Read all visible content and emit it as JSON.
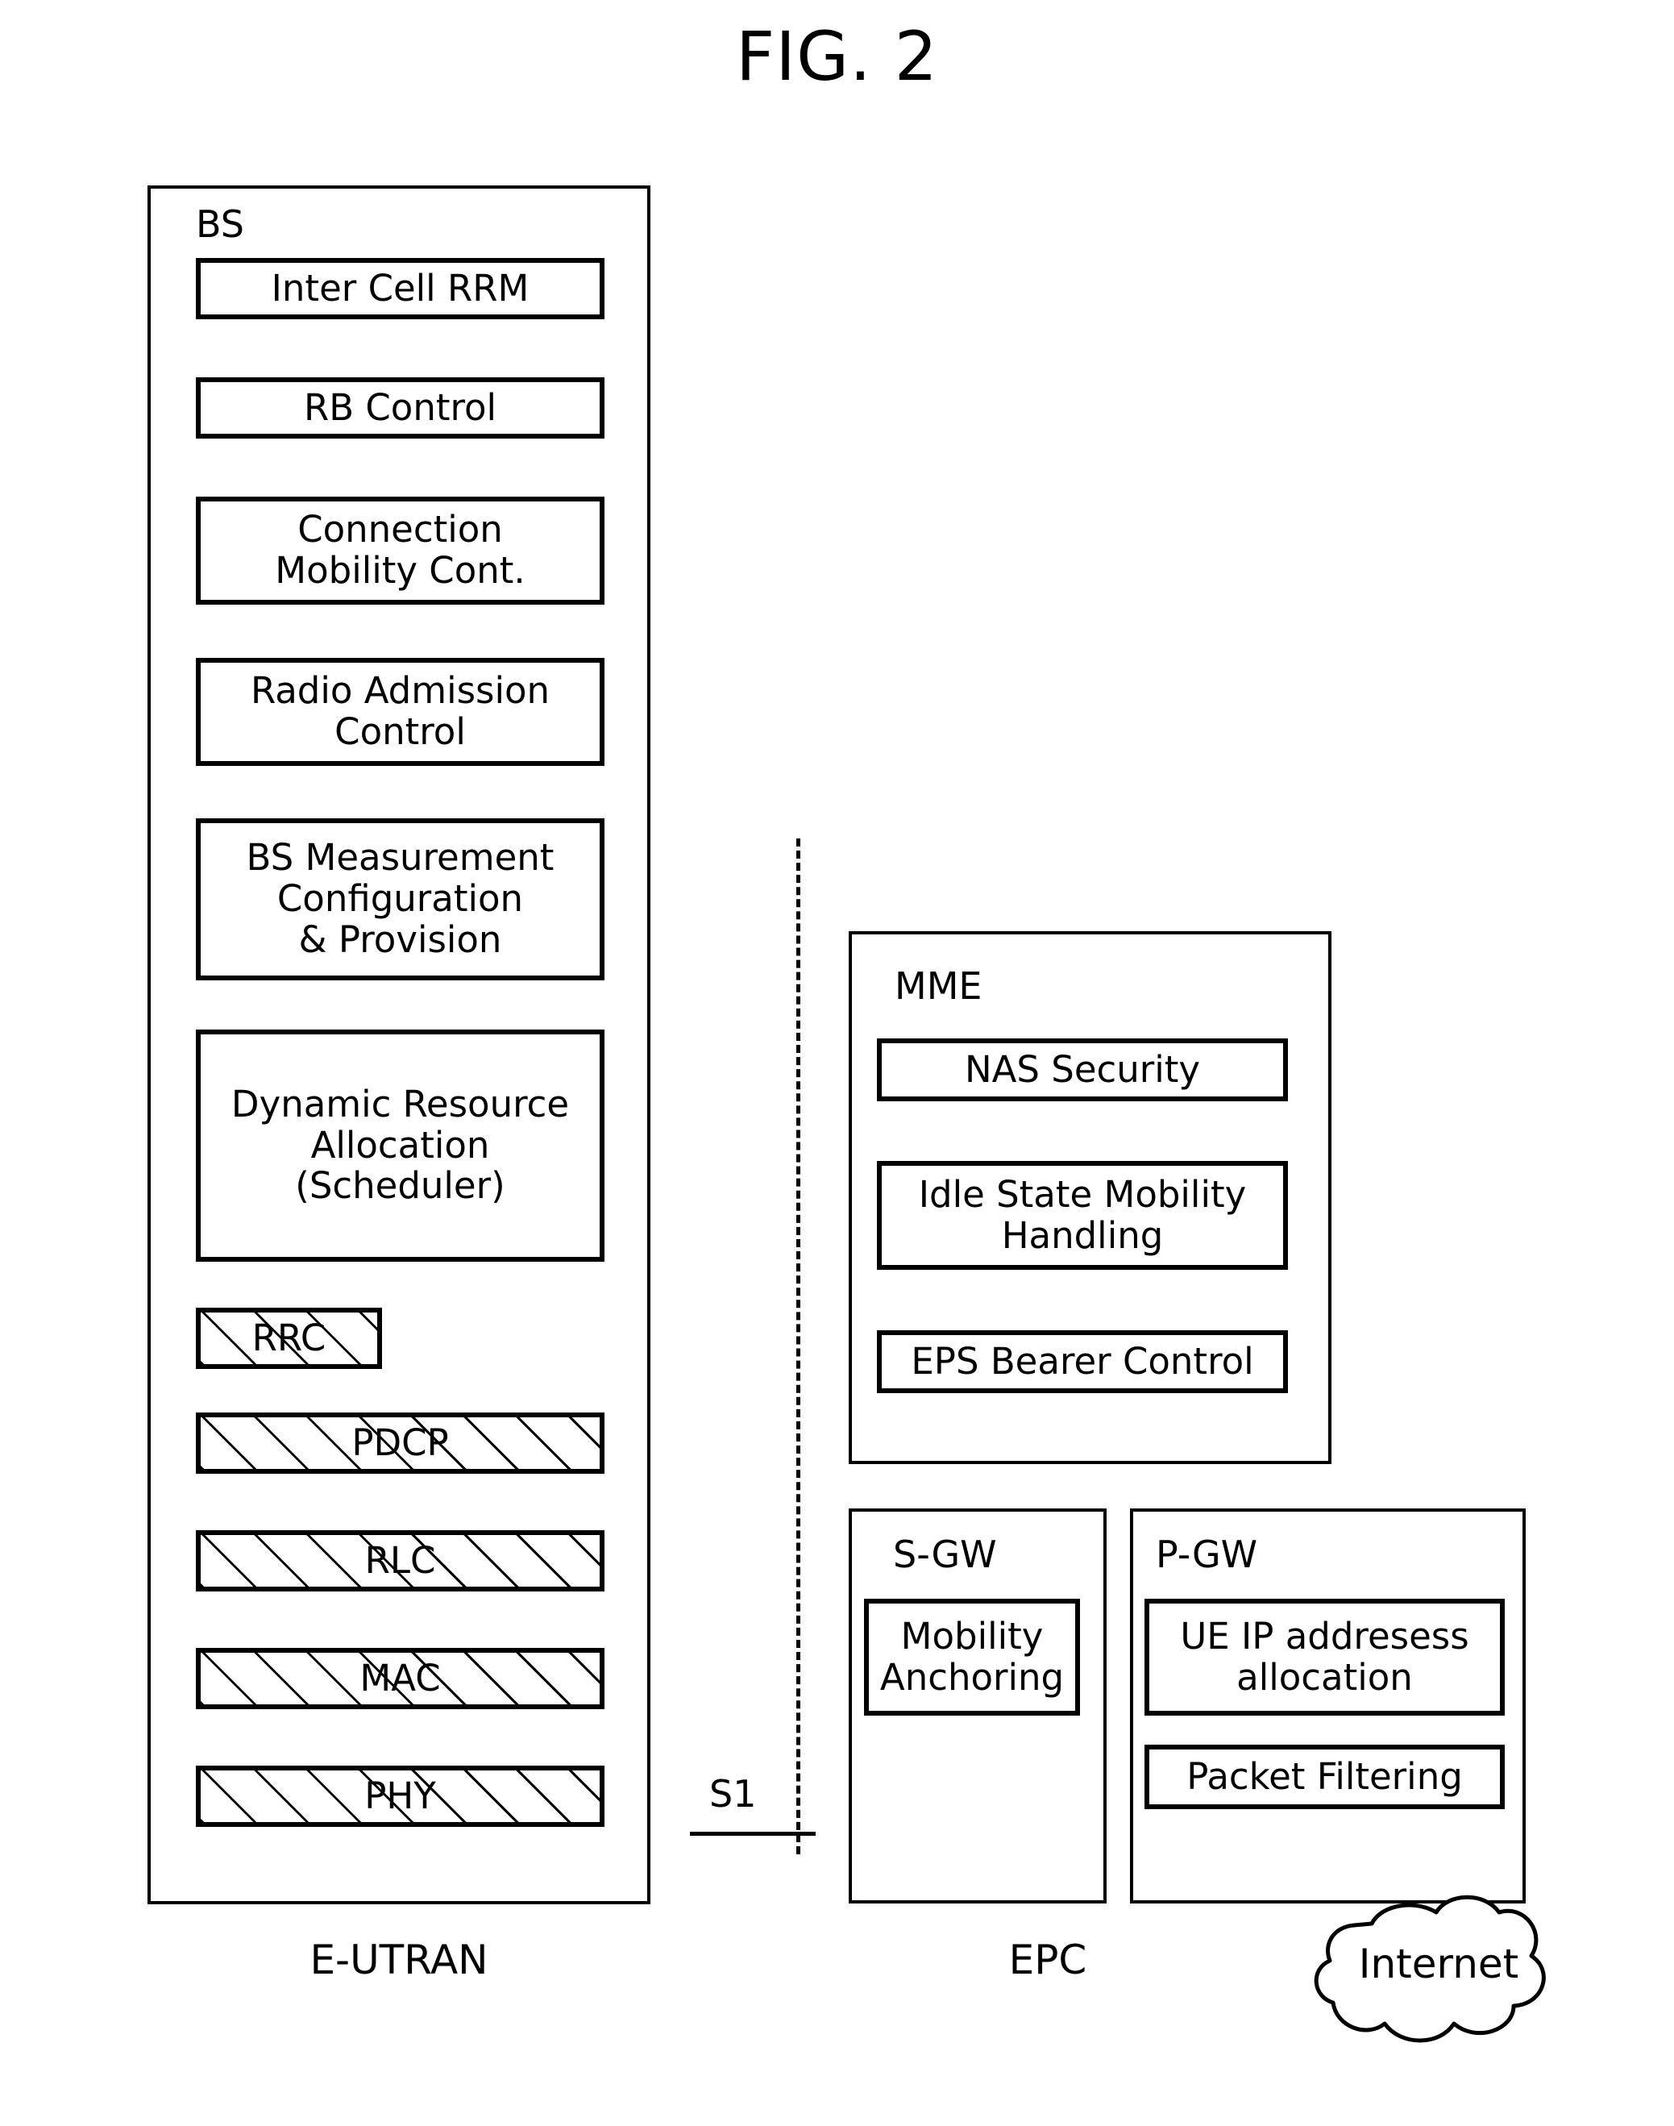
{
  "figure": {
    "title": "FIG. 2"
  },
  "eutran": {
    "group_label": "BS",
    "caption": "E-UTRAN",
    "function_blocks": [
      {
        "label": "Inter Cell RRM"
      },
      {
        "label": "RB Control"
      },
      {
        "label": "Connection\nMobility Cont."
      },
      {
        "label": "Radio Admission\nControl"
      },
      {
        "label": "BS Measurement\nConfiguration\n& Provision"
      },
      {
        "label": "Dynamic Resource\nAllocation\n(Scheduler)"
      }
    ],
    "protocol_stack": [
      {
        "label": "RRC"
      },
      {
        "label": "PDCP"
      },
      {
        "label": "RLC"
      },
      {
        "label": "MAC"
      },
      {
        "label": "PHY"
      }
    ]
  },
  "interface": {
    "label": "S1"
  },
  "epc": {
    "caption": "EPC",
    "mme": {
      "group_label": "MME",
      "blocks": [
        {
          "label": "NAS Security"
        },
        {
          "label": "Idle State Mobility\nHandling"
        },
        {
          "label": "EPS Bearer Control"
        }
      ]
    },
    "sgw": {
      "group_label": "S-GW",
      "blocks": [
        {
          "label": "Mobility\nAnchoring"
        }
      ]
    },
    "pgw": {
      "group_label": "P-GW",
      "blocks": [
        {
          "label": "UE IP addresess\nallocation"
        },
        {
          "label": "Packet Filtering"
        }
      ]
    }
  },
  "internet": {
    "label": "Internet"
  },
  "colors": {
    "line": "#000000",
    "background": "#ffffff"
  }
}
